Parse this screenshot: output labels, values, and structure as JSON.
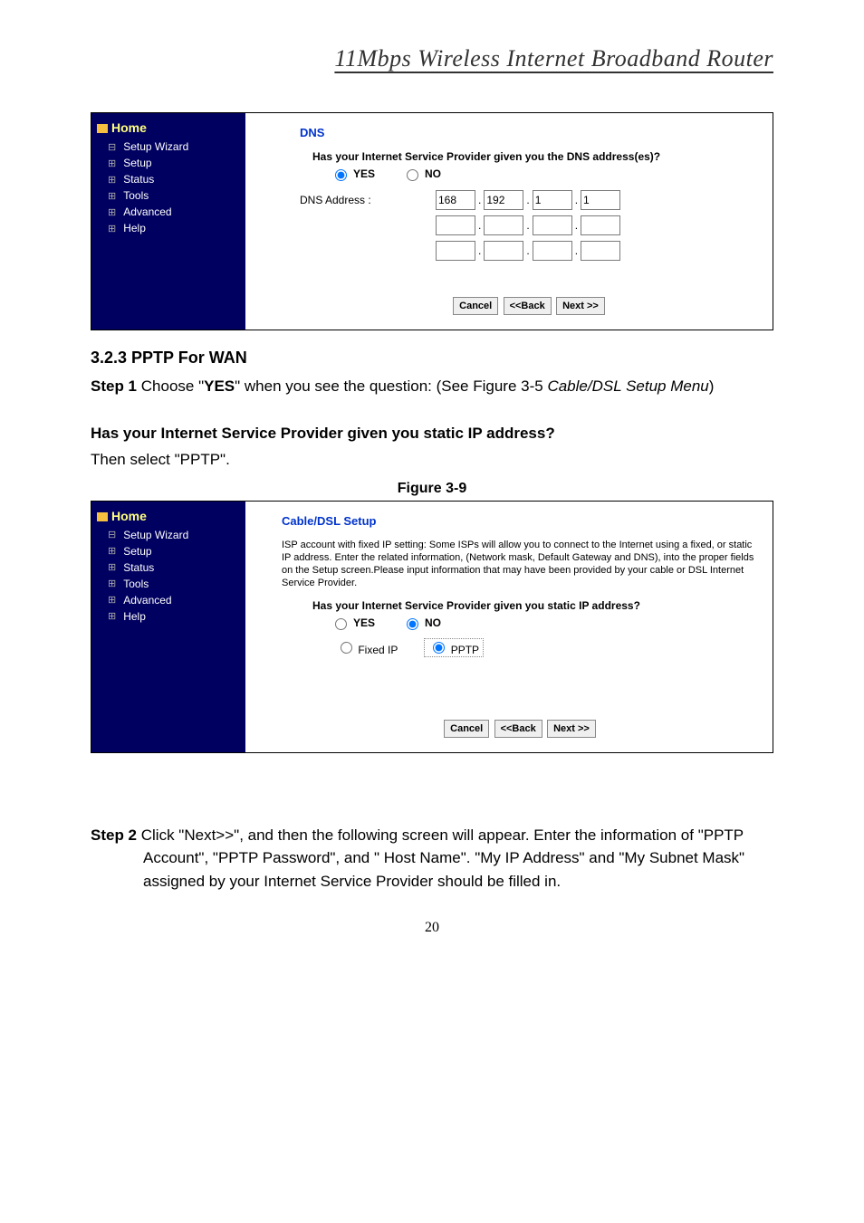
{
  "header": {
    "title": "11Mbps  Wireless  Internet  Broadband  Router"
  },
  "sidebar": {
    "home": "Home",
    "items": [
      "Setup Wizard",
      "Setup",
      "Status",
      "Tools",
      "Advanced",
      "Help"
    ]
  },
  "fig1": {
    "title": "DNS",
    "question": "Has your Internet Service Provider given you the DNS address(es)?",
    "yes": "YES",
    "no": "NO",
    "dns_label": "DNS Address :",
    "ip1": [
      "168",
      "192",
      "1",
      "1"
    ],
    "buttons": {
      "cancel": "Cancel",
      "back": "<<Back",
      "next": "Next >>"
    }
  },
  "section": {
    "heading": "3.2.3 PPTP For WAN",
    "step1_a": "Step 1",
    "step1_b": " Choose \"",
    "step1_c": "YES",
    "step1_d": "\" when you see the question: (See Figure 3-5 ",
    "step1_e": "Cable/DSL Setup Menu",
    "step1_f": ")",
    "q2": "Has your Internet Service Provider given you static IP address?",
    "then": "Then select \"PPTP\".",
    "fig_caption": "Figure 3-9",
    "step2_a": "Step 2",
    "step2_b": " Click \"Next>>\", and then the following screen will appear. Enter the information of \"PPTP Account\", \"PPTP Password\", and \" Host Name\". \"My IP Address\" and \"My Subnet Mask\" assigned by your Internet Service Provider should be filled in."
  },
  "fig2": {
    "title": "Cable/DSL Setup",
    "desc": "ISP account with fixed IP setting: Some ISPs will allow you to connect to the Internet using a fixed, or static IP address. Enter the related information, (Network mask, Default Gateway and DNS), into the proper fields on the Setup screen.Please input information that may have been provided by your cable or DSL Internet Service Provider.",
    "question": "Has your Internet Service Provider given you static IP address?",
    "yes": "YES",
    "no": "NO",
    "fixed": "Fixed IP",
    "pptp": "PPTP",
    "buttons": {
      "cancel": "Cancel",
      "back": "<<Back",
      "next": "Next >>"
    }
  },
  "page_number": "20"
}
